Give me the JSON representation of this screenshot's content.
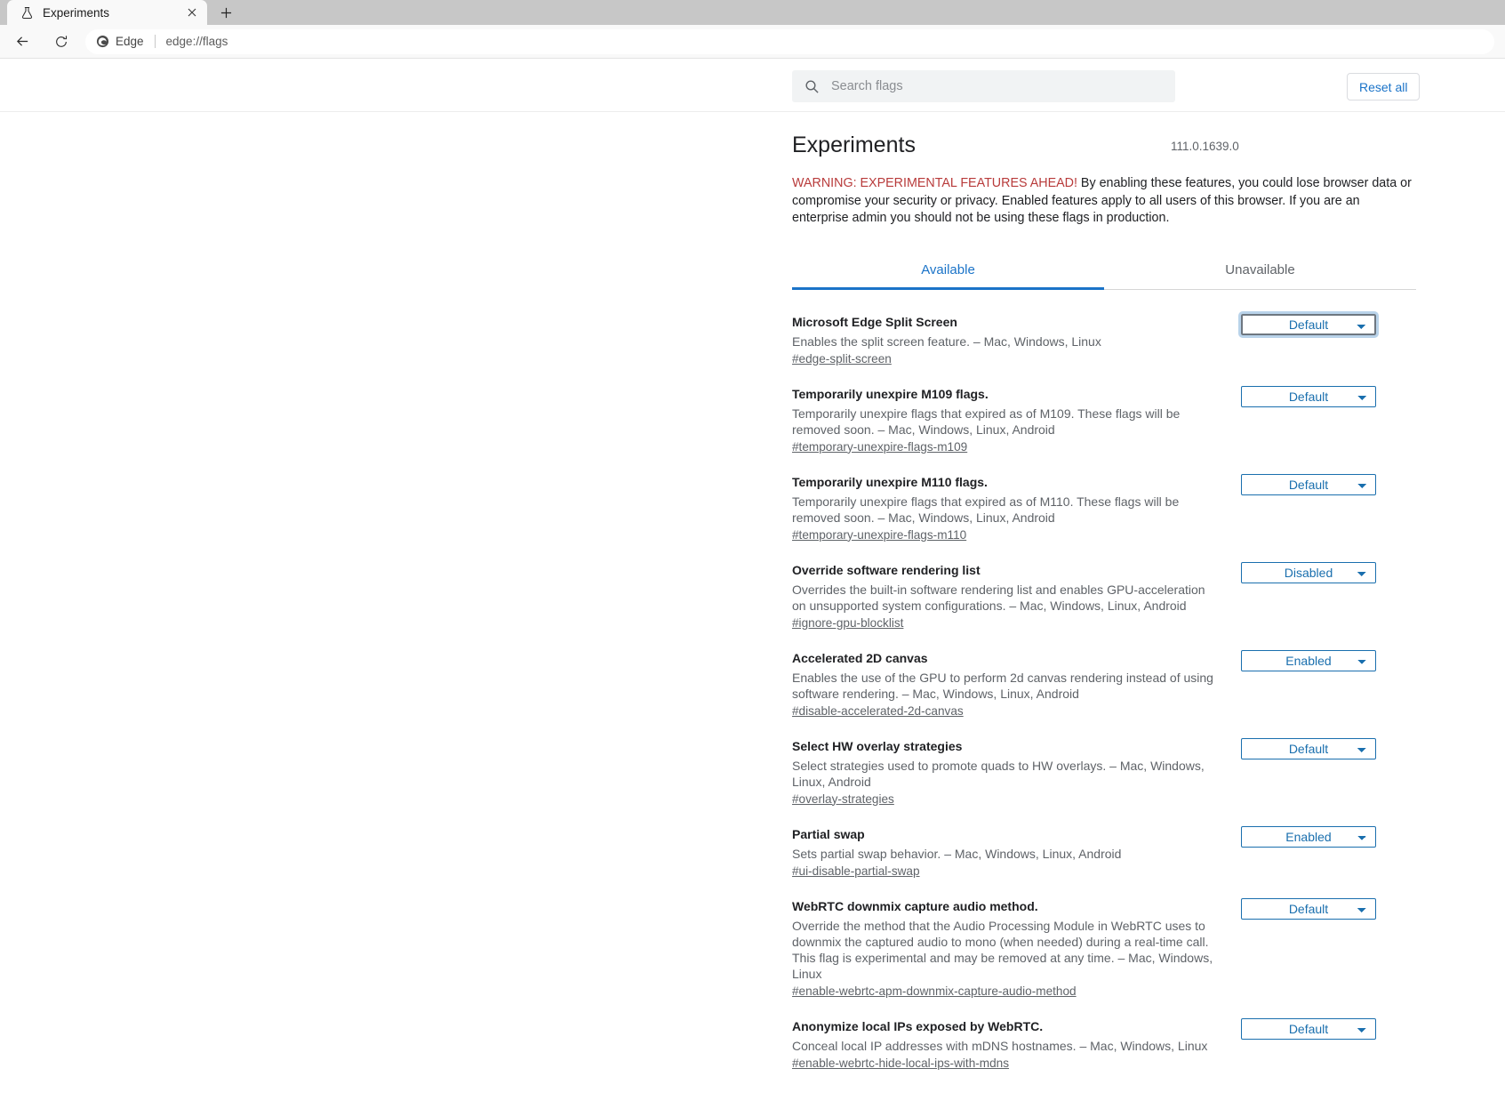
{
  "browser": {
    "tab": {
      "title": "Experiments",
      "favicon_icon": "flask-icon",
      "close_icon": "close-icon"
    },
    "new_tab_label": "+",
    "back_icon": "back-arrow-icon",
    "reload_icon": "reload-icon",
    "omnibox": {
      "brand": "Edge",
      "brand_icon": "edge-logo-icon",
      "url": "edge://flags"
    }
  },
  "header": {
    "search": {
      "placeholder": "Search flags",
      "value": "",
      "icon": "search-icon"
    },
    "reset_all_label": "Reset all"
  },
  "main": {
    "title": "Experiments",
    "version": "111.0.1639.0",
    "warning_lead": "WARNING: EXPERIMENTAL FEATURES AHEAD!",
    "warning_body": " By enabling these features, you could lose browser data or compromise your security or privacy. Enabled features apply to all users of this browser. If you are an enterprise admin you should not be using these flags in production.",
    "tabs": [
      {
        "label": "Available",
        "active": true
      },
      {
        "label": "Unavailable",
        "active": false
      }
    ],
    "select_options": [
      "Default",
      "Enabled",
      "Disabled"
    ],
    "flags": [
      {
        "name": "Microsoft Edge Split Screen",
        "description": "Enables the split screen feature. – Mac, Windows, Linux",
        "anchor": "#edge-split-screen",
        "value": "Default",
        "focused": true
      },
      {
        "name": "Temporarily unexpire M109 flags.",
        "description": "Temporarily unexpire flags that expired as of M109. These flags will be removed soon. – Mac, Windows, Linux, Android",
        "anchor": "#temporary-unexpire-flags-m109",
        "value": "Default",
        "focused": false
      },
      {
        "name": "Temporarily unexpire M110 flags.",
        "description": "Temporarily unexpire flags that expired as of M110. These flags will be removed soon. – Mac, Windows, Linux, Android",
        "anchor": "#temporary-unexpire-flags-m110",
        "value": "Default",
        "focused": false
      },
      {
        "name": "Override software rendering list",
        "description": "Overrides the built-in software rendering list and enables GPU-acceleration on unsupported system configurations. – Mac, Windows, Linux, Android",
        "anchor": "#ignore-gpu-blocklist",
        "value": "Disabled",
        "focused": false
      },
      {
        "name": "Accelerated 2D canvas",
        "description": "Enables the use of the GPU to perform 2d canvas rendering instead of using software rendering. – Mac, Windows, Linux, Android",
        "anchor": "#disable-accelerated-2d-canvas",
        "value": "Enabled",
        "focused": false
      },
      {
        "name": "Select HW overlay strategies",
        "description": "Select strategies used to promote quads to HW overlays. – Mac, Windows, Linux, Android",
        "anchor": "#overlay-strategies",
        "value": "Default",
        "focused": false
      },
      {
        "name": "Partial swap",
        "description": "Sets partial swap behavior. – Mac, Windows, Linux, Android",
        "anchor": "#ui-disable-partial-swap",
        "value": "Enabled",
        "focused": false
      },
      {
        "name": "WebRTC downmix capture audio method.",
        "description": "Override the method that the Audio Processing Module in WebRTC uses to downmix the captured audio to mono (when needed) during a real-time call. This flag is experimental and may be removed at any time. – Mac, Windows, Linux",
        "anchor": "#enable-webrtc-apm-downmix-capture-audio-method",
        "value": "Default",
        "focused": false
      },
      {
        "name": "Anonymize local IPs exposed by WebRTC.",
        "description": "Conceal local IP addresses with mDNS hostnames. – Mac, Windows, Linux",
        "anchor": "#enable-webrtc-hide-local-ips-with-mdns",
        "value": "Default",
        "focused": false
      }
    ]
  }
}
